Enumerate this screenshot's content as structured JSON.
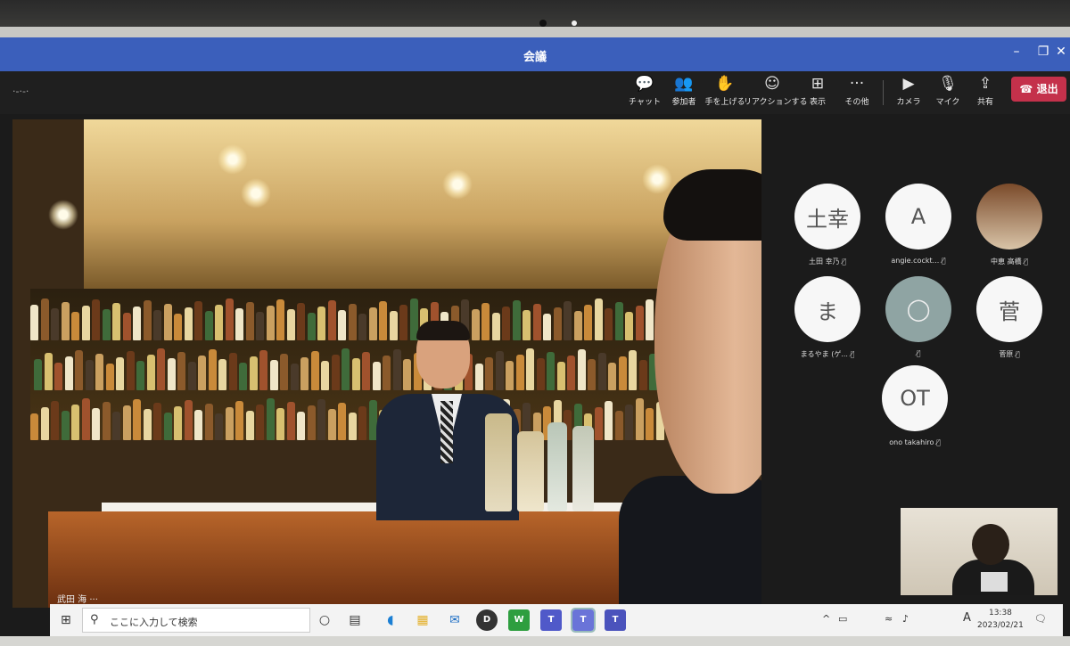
{
  "window": {
    "title": "会議",
    "minimize": "–",
    "maximize": "❐",
    "close": "✕"
  },
  "toolbar": {
    "timer": "·-·-·",
    "buttons": [
      {
        "label": "チャット",
        "icon": "chat-icon",
        "glyph": "💬"
      },
      {
        "label": "参加者",
        "icon": "people-icon",
        "glyph": "👥"
      },
      {
        "label": "手を上げる",
        "icon": "raise-hand-icon",
        "glyph": "✋"
      },
      {
        "label": "リアクションする",
        "icon": "reaction-icon",
        "glyph": "☺"
      },
      {
        "label": "表示",
        "icon": "view-icon",
        "glyph": "⊞"
      },
      {
        "label": "その他",
        "icon": "more-icon",
        "glyph": "···"
      },
      {
        "label": "カメラ",
        "icon": "camera-icon",
        "glyph": "▶"
      },
      {
        "label": "マイク",
        "icon": "mic-icon",
        "glyph": "🎙"
      },
      {
        "label": "共有",
        "icon": "share-icon",
        "glyph": "⇪"
      }
    ],
    "leave_label": "退出",
    "leave_glyph": "☎"
  },
  "main_video": {
    "speaker_name": "武田 海 ···"
  },
  "participants": [
    {
      "initials": "土幸",
      "name": "土田 幸乃",
      "style": ""
    },
    {
      "initials": "A",
      "name": "angie.cockt...",
      "style": ""
    },
    {
      "initials": "",
      "name": "中恵 高橋",
      "style": "photo"
    },
    {
      "initials": "ま",
      "name": "まるやま (ゲ...",
      "style": ""
    },
    {
      "initials": "",
      "name": "",
      "style": "grey"
    },
    {
      "initials": "菅",
      "name": "菅原",
      "style": ""
    },
    {
      "initials": "OT",
      "name": "ono takahiro",
      "style": ""
    }
  ],
  "mic_off_glyph": "🎙̸",
  "taskbar": {
    "search_placeholder": "ここに入力して検索",
    "time": "13:38",
    "date": "2023/02/21",
    "ime": "A",
    "tray_arrow": "^",
    "notification": "🗨"
  },
  "colors": {
    "titlebar": "#3b5fbb",
    "leave": "#c4314b",
    "toolbar": "#1f1f1f"
  }
}
